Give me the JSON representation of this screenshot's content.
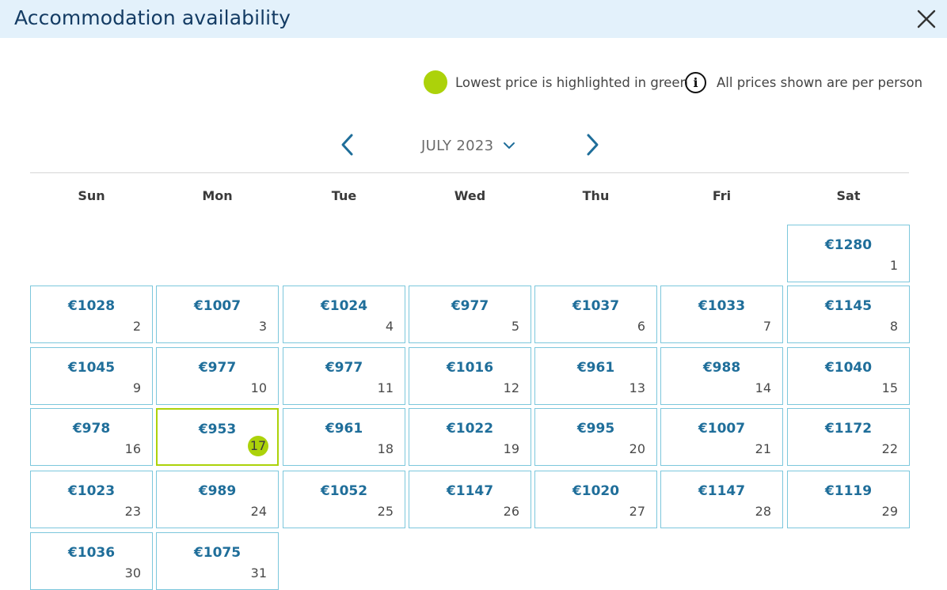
{
  "header": {
    "title": "Accommodation availability",
    "close_icon": "close-icon"
  },
  "legend": {
    "lowest_label": "Lowest price is highlighted in green",
    "lowest_color": "#acd20a",
    "info_glyph": "i",
    "info_label": "All prices shown are per person"
  },
  "calendar": {
    "month_label": "JULY 2023",
    "weekdays": [
      "Sun",
      "Mon",
      "Tue",
      "Wed",
      "Thu",
      "Fri",
      "Sat"
    ],
    "accent_color": "#1f6e9a",
    "border_color": "#7cc7dc",
    "days": [
      {
        "day": "1",
        "price": "€1280"
      },
      {
        "day": "2",
        "price": "€1028"
      },
      {
        "day": "3",
        "price": "€1007"
      },
      {
        "day": "4",
        "price": "€1024"
      },
      {
        "day": "5",
        "price": "€977"
      },
      {
        "day": "6",
        "price": "€1037"
      },
      {
        "day": "7",
        "price": "€1033"
      },
      {
        "day": "8",
        "price": "€1145"
      },
      {
        "day": "9",
        "price": "€1045"
      },
      {
        "day": "10",
        "price": "€977"
      },
      {
        "day": "11",
        "price": "€977"
      },
      {
        "day": "12",
        "price": "€1016"
      },
      {
        "day": "13",
        "price": "€961"
      },
      {
        "day": "14",
        "price": "€988"
      },
      {
        "day": "15",
        "price": "€1040"
      },
      {
        "day": "16",
        "price": "€978"
      },
      {
        "day": "17",
        "price": "€953",
        "lowest": true
      },
      {
        "day": "18",
        "price": "€961"
      },
      {
        "day": "19",
        "price": "€1022"
      },
      {
        "day": "20",
        "price": "€995"
      },
      {
        "day": "21",
        "price": "€1007"
      },
      {
        "day": "22",
        "price": "€1172"
      },
      {
        "day": "23",
        "price": "€1023"
      },
      {
        "day": "24",
        "price": "€989"
      },
      {
        "day": "25",
        "price": "€1052"
      },
      {
        "day": "26",
        "price": "€1147"
      },
      {
        "day": "27",
        "price": "€1020"
      },
      {
        "day": "28",
        "price": "€1147"
      },
      {
        "day": "29",
        "price": "€1119"
      },
      {
        "day": "30",
        "price": "€1036"
      },
      {
        "day": "31",
        "price": "€1075"
      }
    ]
  }
}
